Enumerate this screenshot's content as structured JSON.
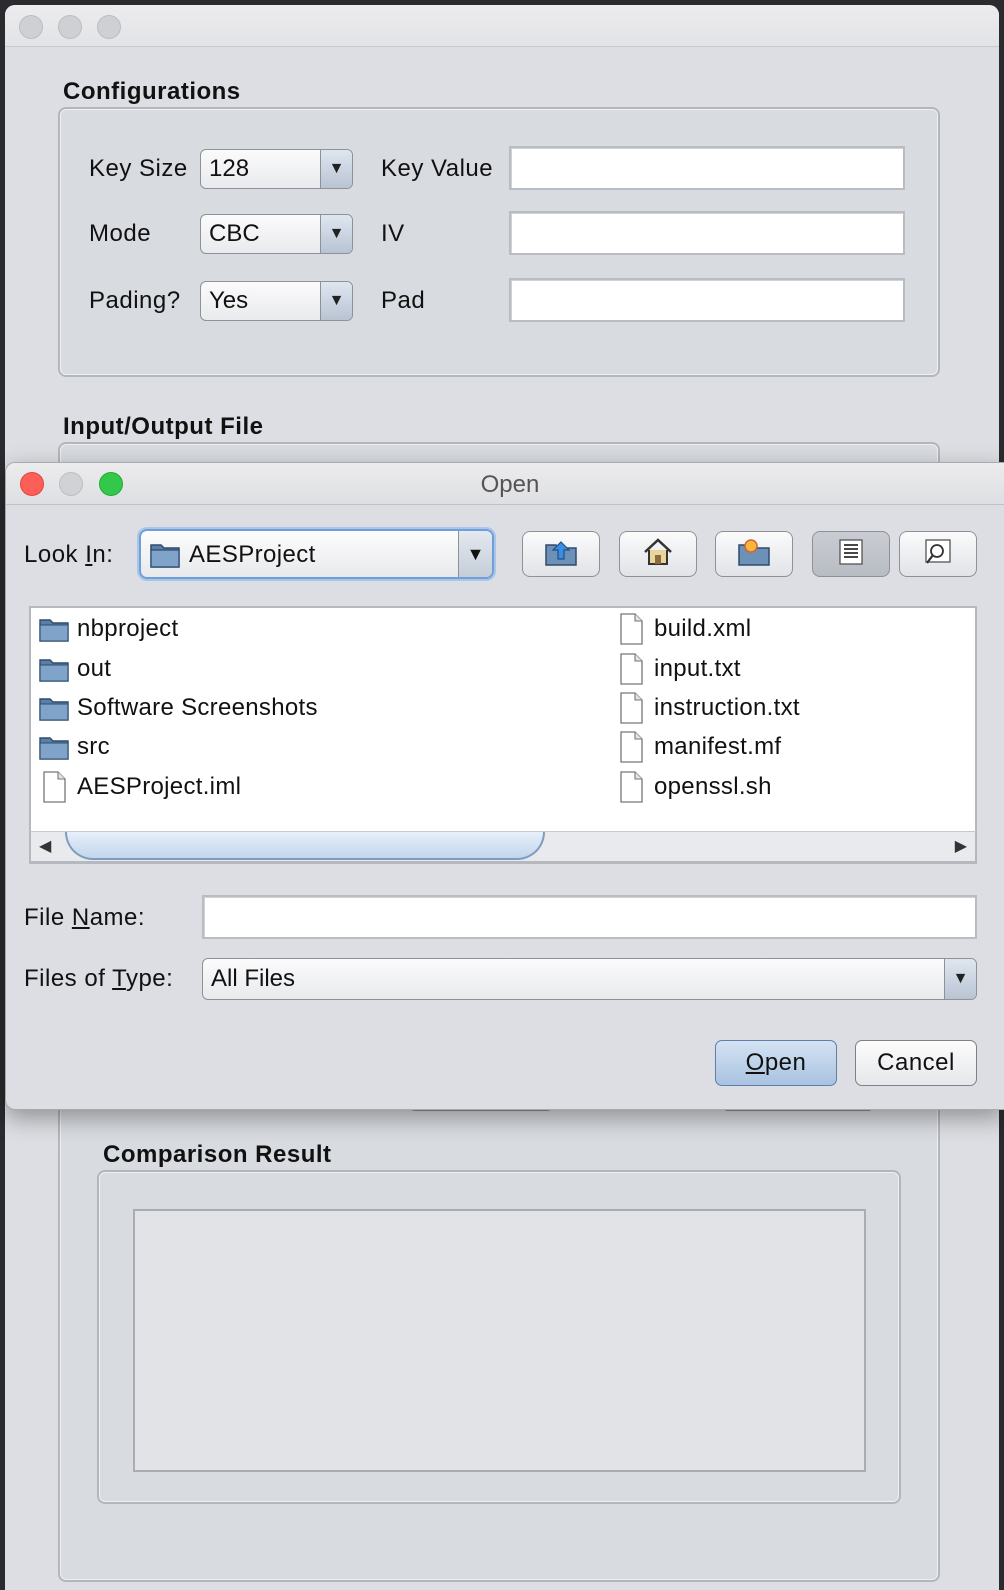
{
  "main": {
    "configurations_title": "Configurations",
    "key_size_label": "Key Size",
    "key_size_value": "128",
    "mode_label": "Mode",
    "mode_value": "CBC",
    "padding_label": "Pading?",
    "padding_value": "Yes",
    "key_value_label": "Key Value",
    "key_value": "",
    "iv_label": "IV",
    "iv_value": "",
    "pad_label": "Pad",
    "pad_value": "",
    "io_title": "Input/Output File",
    "comparison_title": "Comparison Result",
    "comparison_text": ""
  },
  "dialog": {
    "title": "Open",
    "look_in_label_pre": "Look ",
    "look_in_label_mn": "I",
    "look_in_label_post": "n:",
    "look_in_value": "AESProject",
    "toolbar": {
      "up_icon": "up-folder-icon",
      "home_icon": "home-icon",
      "new_folder_icon": "new-folder-icon",
      "list_icon": "list-view-icon",
      "details_icon": "details-view-icon"
    },
    "files": [
      {
        "name": "nbproject",
        "type": "folder"
      },
      {
        "name": "out",
        "type": "folder"
      },
      {
        "name": "Software Screenshots",
        "type": "folder"
      },
      {
        "name": "src",
        "type": "folder"
      },
      {
        "name": "AESProject.iml",
        "type": "file"
      },
      {
        "name": "build.xml",
        "type": "file"
      },
      {
        "name": "input.txt",
        "type": "file"
      },
      {
        "name": "instruction.txt",
        "type": "file"
      },
      {
        "name": "manifest.mf",
        "type": "file"
      },
      {
        "name": "openssl.sh",
        "type": "file"
      }
    ],
    "file_name_label_pre": "File ",
    "file_name_label_mn": "N",
    "file_name_label_post": "ame:",
    "file_name_value": "",
    "file_type_label_pre": "Files of ",
    "file_type_label_mn": "T",
    "file_type_label_post": "ype:",
    "file_type_value": "All Files",
    "open_mn": "O",
    "open_rest": "pen",
    "cancel": "Cancel"
  },
  "colors": {
    "window_bg": "#dcdee3",
    "accent": "#6f9fd8",
    "close": "#fc5f57",
    "zoom": "#34c84a"
  }
}
